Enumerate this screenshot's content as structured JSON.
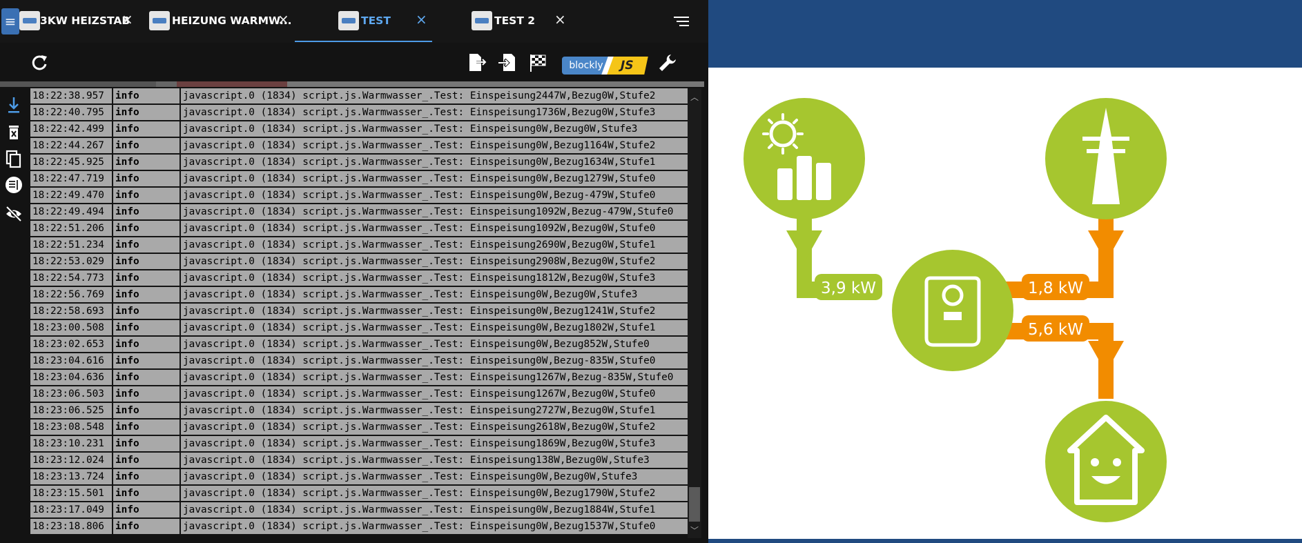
{
  "tabs": [
    {
      "label": "3KW HEIZSTAB",
      "close": "×"
    },
    {
      "label": "HEIZUNG WARMW...",
      "close": "×"
    },
    {
      "label": "TEST",
      "close": "×"
    },
    {
      "label": "TEST 2",
      "close": "×"
    }
  ],
  "toolbar": {
    "blockly_label": "blockly",
    "js_label": "JS"
  },
  "colors": {
    "accent": "#4d9be6",
    "solar_green": "#a6c62f",
    "grid_orange": "#f28c00",
    "header_blue": "#204a80"
  },
  "log": [
    {
      "time": "18:22:38.957",
      "severity": "info",
      "message": "javascript.0 (1834) script.js.Warmwasser_.Test: Einspeisung2447W,Bezug0W,Stufe2"
    },
    {
      "time": "18:22:40.795",
      "severity": "info",
      "message": "javascript.0 (1834) script.js.Warmwasser_.Test: Einspeisung1736W,Bezug0W,Stufe3"
    },
    {
      "time": "18:22:42.499",
      "severity": "info",
      "message": "javascript.0 (1834) script.js.Warmwasser_.Test: Einspeisung0W,Bezug0W,Stufe3"
    },
    {
      "time": "18:22:44.267",
      "severity": "info",
      "message": "javascript.0 (1834) script.js.Warmwasser_.Test: Einspeisung0W,Bezug1164W,Stufe2"
    },
    {
      "time": "18:22:45.925",
      "severity": "info",
      "message": "javascript.0 (1834) script.js.Warmwasser_.Test: Einspeisung0W,Bezug1634W,Stufe1"
    },
    {
      "time": "18:22:47.719",
      "severity": "info",
      "message": "javascript.0 (1834) script.js.Warmwasser_.Test: Einspeisung0W,Bezug1279W,Stufe0"
    },
    {
      "time": "18:22:49.470",
      "severity": "info",
      "message": "javascript.0 (1834) script.js.Warmwasser_.Test: Einspeisung0W,Bezug-479W,Stufe0"
    },
    {
      "time": "18:22:49.494",
      "severity": "info",
      "message": "javascript.0 (1834) script.js.Warmwasser_.Test: Einspeisung1092W,Bezug-479W,Stufe0"
    },
    {
      "time": "18:22:51.206",
      "severity": "info",
      "message": "javascript.0 (1834) script.js.Warmwasser_.Test: Einspeisung1092W,Bezug0W,Stufe0"
    },
    {
      "time": "18:22:51.234",
      "severity": "info",
      "message": "javascript.0 (1834) script.js.Warmwasser_.Test: Einspeisung2690W,Bezug0W,Stufe1"
    },
    {
      "time": "18:22:53.029",
      "severity": "info",
      "message": "javascript.0 (1834) script.js.Warmwasser_.Test: Einspeisung2908W,Bezug0W,Stufe2"
    },
    {
      "time": "18:22:54.773",
      "severity": "info",
      "message": "javascript.0 (1834) script.js.Warmwasser_.Test: Einspeisung1812W,Bezug0W,Stufe3"
    },
    {
      "time": "18:22:56.769",
      "severity": "info",
      "message": "javascript.0 (1834) script.js.Warmwasser_.Test: Einspeisung0W,Bezug0W,Stufe3"
    },
    {
      "time": "18:22:58.693",
      "severity": "info",
      "message": "javascript.0 (1834) script.js.Warmwasser_.Test: Einspeisung0W,Bezug1241W,Stufe2"
    },
    {
      "time": "18:23:00.508",
      "severity": "info",
      "message": "javascript.0 (1834) script.js.Warmwasser_.Test: Einspeisung0W,Bezug1802W,Stufe1"
    },
    {
      "time": "18:23:02.653",
      "severity": "info",
      "message": "javascript.0 (1834) script.js.Warmwasser_.Test: Einspeisung0W,Bezug852W,Stufe0"
    },
    {
      "time": "18:23:04.616",
      "severity": "info",
      "message": "javascript.0 (1834) script.js.Warmwasser_.Test: Einspeisung0W,Bezug-835W,Stufe0"
    },
    {
      "time": "18:23:04.636",
      "severity": "info",
      "message": "javascript.0 (1834) script.js.Warmwasser_.Test: Einspeisung1267W,Bezug-835W,Stufe0"
    },
    {
      "time": "18:23:06.503",
      "severity": "info",
      "message": "javascript.0 (1834) script.js.Warmwasser_.Test: Einspeisung1267W,Bezug0W,Stufe0"
    },
    {
      "time": "18:23:06.525",
      "severity": "info",
      "message": "javascript.0 (1834) script.js.Warmwasser_.Test: Einspeisung2727W,Bezug0W,Stufe1"
    },
    {
      "time": "18:23:08.548",
      "severity": "info",
      "message": "javascript.0 (1834) script.js.Warmwasser_.Test: Einspeisung2618W,Bezug0W,Stufe2"
    },
    {
      "time": "18:23:10.231",
      "severity": "info",
      "message": "javascript.0 (1834) script.js.Warmwasser_.Test: Einspeisung1869W,Bezug0W,Stufe3"
    },
    {
      "time": "18:23:12.024",
      "severity": "info",
      "message": "javascript.0 (1834) script.js.Warmwasser_.Test: Einspeisung138W,Bezug0W,Stufe3"
    },
    {
      "time": "18:23:13.724",
      "severity": "info",
      "message": "javascript.0 (1834) script.js.Warmwasser_.Test: Einspeisung0W,Bezug0W,Stufe3"
    },
    {
      "time": "18:23:15.501",
      "severity": "info",
      "message": "javascript.0 (1834) script.js.Warmwasser_.Test: Einspeisung0W,Bezug1790W,Stufe2"
    },
    {
      "time": "18:23:17.049",
      "severity": "info",
      "message": "javascript.0 (1834) script.js.Warmwasser_.Test: Einspeisung0W,Bezug1884W,Stufe1"
    },
    {
      "time": "18:23:18.806",
      "severity": "info",
      "message": "javascript.0 (1834) script.js.Warmwasser_.Test: Einspeisung0W,Bezug1537W,Stufe0"
    }
  ],
  "energy_flow": {
    "solar_power": "3,9 kW",
    "grid_power": "1,8 kW",
    "house_power": "5,6 kW"
  }
}
